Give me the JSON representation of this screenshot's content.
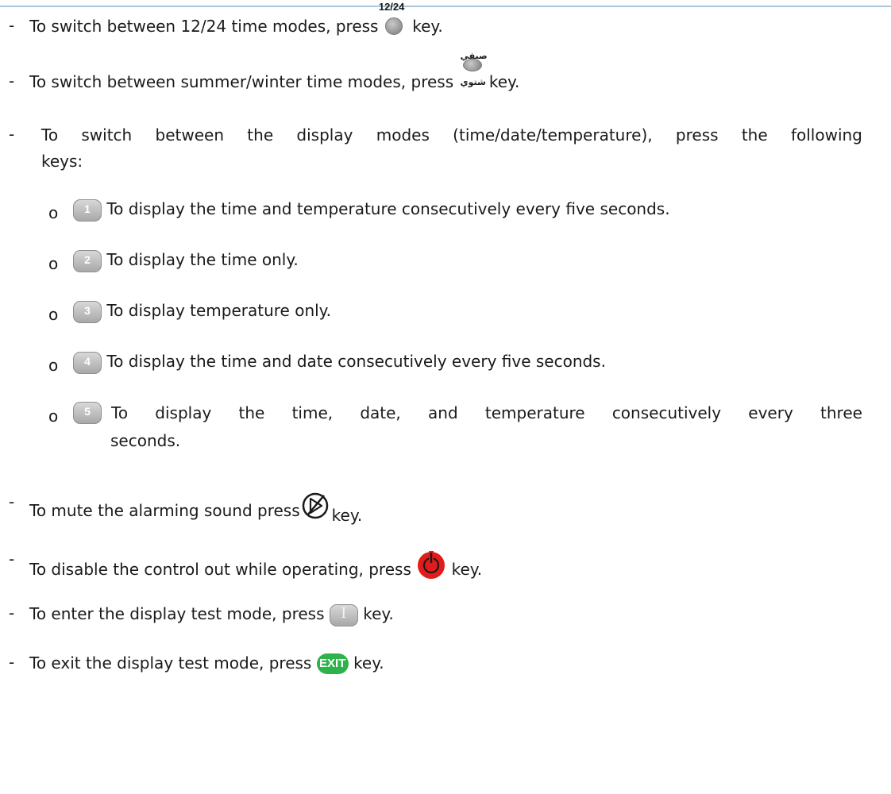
{
  "line_1": {
    "key_label": "12/24",
    "text_before": "To switch between 12/24 time modes, press",
    "text_after": "key."
  },
  "line_2": {
    "key_label_top": "صيفي",
    "key_label_bottom": "شتوي",
    "text_before": "To switch between summer/winter time modes, press",
    "text_after": "key."
  },
  "line_3": {
    "words": [
      "To",
      "switch",
      "between",
      "the",
      "display",
      "modes",
      "(time/date/temperature),",
      "press",
      "the",
      "following"
    ],
    "continuation": "keys:"
  },
  "sub_items": [
    {
      "key": "1",
      "text": "To display the time and temperature consecutively every five seconds."
    },
    {
      "key": "2",
      "text": "To display the time only."
    },
    {
      "key": "3",
      "text": "To display temperature only."
    },
    {
      "key": "4",
      "text": "To display the time and date consecutively every five seconds."
    },
    {
      "key": "5",
      "words": [
        "To",
        "display",
        "the",
        "time,",
        "date,",
        "and",
        "temperature",
        "consecutively",
        "every",
        "three"
      ],
      "continuation": "seconds."
    }
  ],
  "mute": {
    "text_before": "To mute the alarming sound press",
    "text_after": "key.",
    "icon": "mute-icon"
  },
  "disable": {
    "text_before": "To disable the control out while operating, press",
    "text_after": "key.",
    "icon": "power-icon",
    "icon_color": "#e21b1b"
  },
  "test_enter": {
    "key": "I",
    "text_before": "To enter the display test mode, press",
    "text_after": "key."
  },
  "test_exit": {
    "key": "EXIT",
    "key_color": "#2eb34a",
    "text_before": "To exit the display test mode, press",
    "text_after": "key."
  }
}
